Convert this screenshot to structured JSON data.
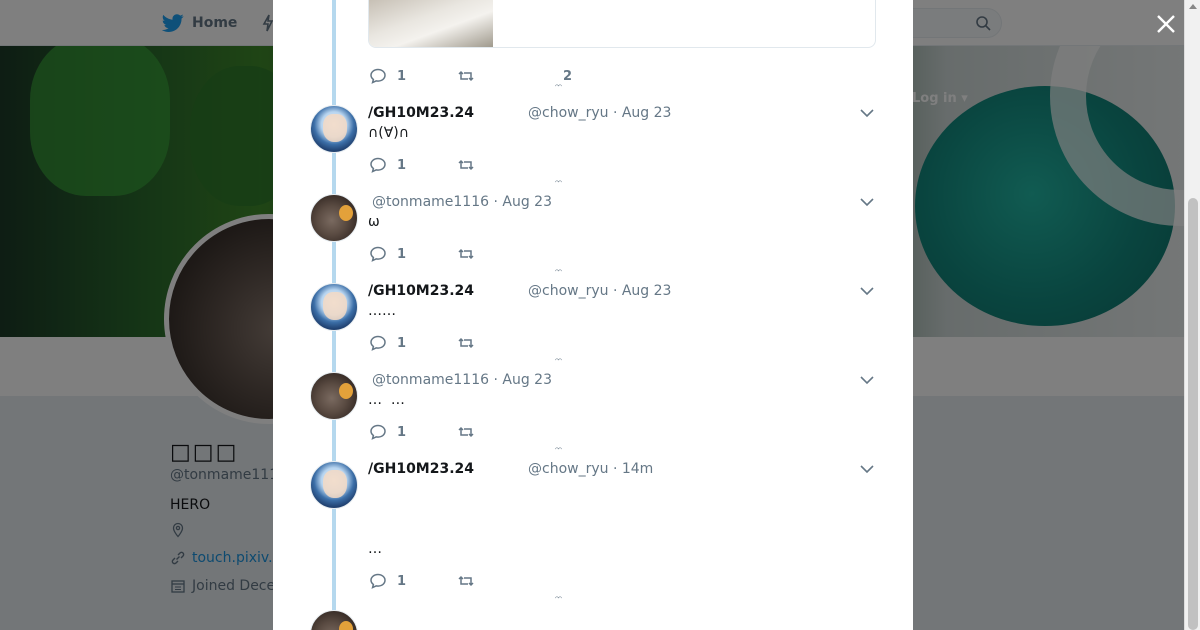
{
  "nav": {
    "home_label": "Home",
    "login_label": "Log in ▾"
  },
  "profile": {
    "name": "□□□",
    "handle": "@tonmame111",
    "bio": "HERO",
    "website": "touch.pixiv.",
    "joined": "Joined Dece"
  },
  "modal": {
    "previous": {
      "replies": "1",
      "likes": "2"
    },
    "tweets": [
      {
        "name": "/GH10M23.24",
        "handle": "@chow_ryu",
        "time": "Aug 23",
        "text": "∩(∀)∩",
        "replies": "1",
        "avatar": "anime"
      },
      {
        "name": "",
        "handle": "@tonmame1116",
        "time": "Aug 23",
        "text": "ω",
        "replies": "1",
        "avatar": "dog"
      },
      {
        "name": "/GH10M23.24",
        "handle": "@chow_ryu",
        "time": "Aug 23",
        "text": "……",
        "replies": "1",
        "avatar": "anime"
      },
      {
        "name": "",
        "handle": "@tonmame1116",
        "time": "Aug 23",
        "text": "…  …",
        "replies": "1",
        "avatar": "dog"
      },
      {
        "name": "/GH10M23.24",
        "handle": "@chow_ryu",
        "time": "14m",
        "text": "…",
        "replies": "1",
        "avatar": "anime"
      }
    ]
  },
  "colors": {
    "brand": "#1da1f2",
    "thread_line": "#b5d8ee",
    "muted": "#657786",
    "link": "#1b95e0"
  },
  "icons": [
    "twitter-bird-icon",
    "lightning-icon",
    "search-icon",
    "close-icon",
    "reply-icon",
    "retweet-icon",
    "like-icon",
    "chevron-down-icon",
    "location-icon",
    "link-icon",
    "calendar-icon"
  ]
}
